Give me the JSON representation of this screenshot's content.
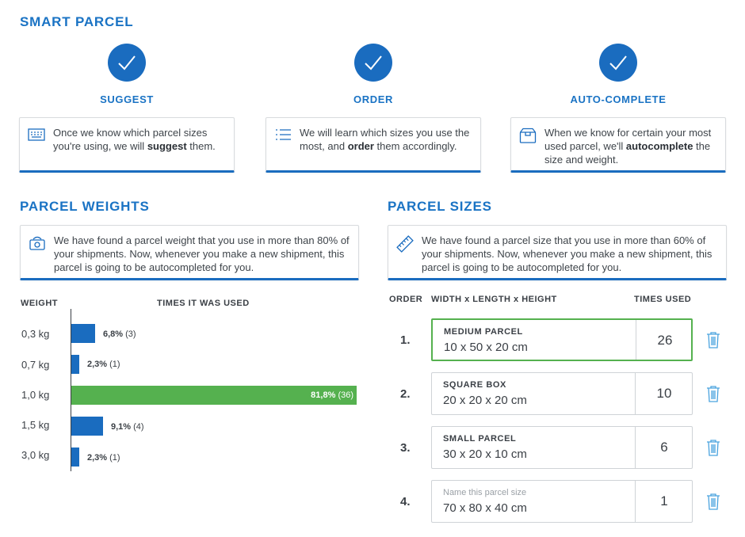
{
  "smart_parcel": {
    "title": "SMART PARCEL",
    "steps": [
      {
        "title": "SUGGEST",
        "icon": "keyboard-icon",
        "text_parts": [
          "Once we know which parcel sizes you're using, we will ",
          "suggest",
          " them."
        ]
      },
      {
        "title": "ORDER",
        "icon": "list-icon",
        "text_parts": [
          "We will learn which sizes you use the most, and ",
          "order",
          " them accordingly."
        ]
      },
      {
        "title": "AUTO-COMPLETE",
        "icon": "box-icon",
        "text_parts": [
          "When we know for certain your most used parcel, we'll ",
          "autocomplete",
          " the size and weight."
        ]
      }
    ]
  },
  "parcel_weights": {
    "title": "PARCEL WEIGHTS",
    "info": "We have found a parcel weight that you use in more than 80% of your shipments. Now, whenever you make a new shipment, this parcel is going to be autocompleted for you.",
    "col_weight": "WEIGHT",
    "col_times": "TIMES IT WAS USED",
    "rows": [
      {
        "weight": "0,3 kg",
        "percent": "6,8%",
        "count": "(3)"
      },
      {
        "weight": "0,7 kg",
        "percent": "2,3%",
        "count": "(1)"
      },
      {
        "weight": "1,0 kg",
        "percent": "81,8%",
        "count": "(36)"
      },
      {
        "weight": "1,5 kg",
        "percent": "9,1%",
        "count": "(4)"
      },
      {
        "weight": "3,0 kg",
        "percent": "2,3%",
        "count": "(1)"
      }
    ]
  },
  "chart_data": {
    "type": "bar",
    "orientation": "horizontal",
    "categories": [
      "0,3 kg",
      "0,7 kg",
      "1,0 kg",
      "1,5 kg",
      "3,0 kg"
    ],
    "values": [
      6.8,
      2.3,
      81.8,
      9.1,
      2.3
    ],
    "counts": [
      3,
      1,
      36,
      4,
      1
    ],
    "xlabel": "TIMES IT WAS USED",
    "ylabel": "WEIGHT",
    "highlight_index": 2,
    "colors": {
      "default": "#1a6cbf",
      "highlight": "#55b14f"
    },
    "grid": false
  },
  "parcel_sizes": {
    "title": "PARCEL SIZES",
    "info": "We have found a parcel size that you use in more than 60% of your shipments. Now, whenever you make a new shipment, this parcel is going to be autocompleted for you.",
    "col_order": "ORDER",
    "col_dims": "WIDTH x LENGTH x HEIGHT",
    "col_times": "TIMES USED",
    "rows": [
      {
        "order": "1.",
        "name": "MEDIUM PARCEL",
        "dims": "10 x 50 x 20 cm",
        "times": "26",
        "active": true
      },
      {
        "order": "2.",
        "name": "SQUARE BOX",
        "dims": "20 x 20 x 20 cm",
        "times": "10"
      },
      {
        "order": "3.",
        "name": "SMALL PARCEL",
        "dims": "30 x 20 x 10 cm",
        "times": "6"
      },
      {
        "order": "4.",
        "placeholder": "Name this parcel size",
        "dims": "70 x 80 x 40 cm",
        "times": "1"
      }
    ]
  },
  "colors": {
    "accent": "#1a73c4",
    "primary": "#1a6cbf",
    "success": "#55b14f",
    "trash": "#4aa3df"
  }
}
